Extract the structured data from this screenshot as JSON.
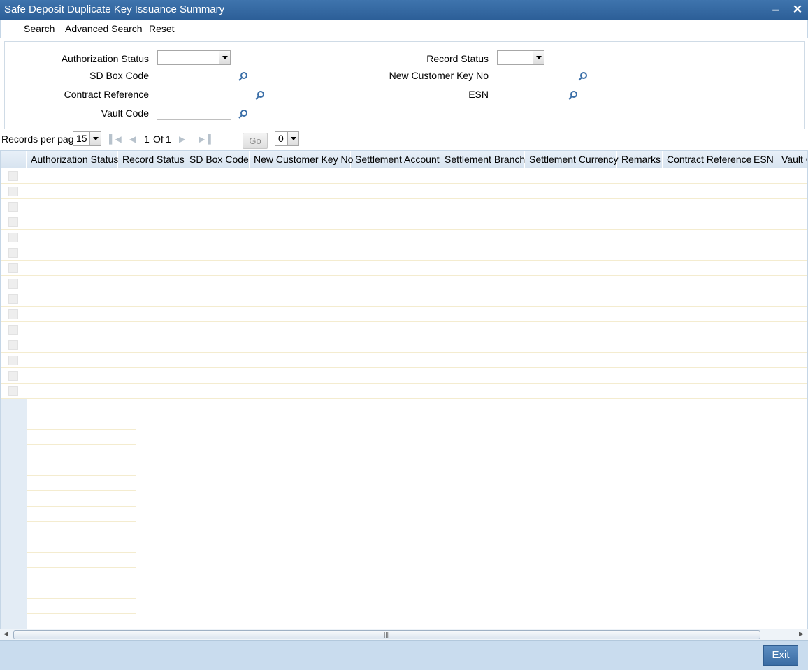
{
  "window": {
    "title": "Safe Deposit Duplicate Key Issuance Summary",
    "minimize_glyph": "‒",
    "close_glyph": "✕"
  },
  "menu": {
    "search": "Search",
    "advanced_search": "Advanced Search",
    "reset": "Reset"
  },
  "criteria": {
    "authorization_status": {
      "label": "Authorization Status",
      "value": ""
    },
    "record_status": {
      "label": "Record Status",
      "value": ""
    },
    "sd_box_code": {
      "label": "SD Box Code",
      "value": ""
    },
    "new_customer_key_no": {
      "label": "New Customer Key No",
      "value": ""
    },
    "contract_reference": {
      "label": "Contract Reference",
      "value": ""
    },
    "esn": {
      "label": "ESN",
      "value": ""
    },
    "vault_code": {
      "label": "Vault Code",
      "value": ""
    }
  },
  "pager": {
    "records_per_page_label": "Records per page",
    "records_per_page_value": "15",
    "current_page": "1",
    "of_label": "Of",
    "total_pages": "1",
    "go_label": "Go",
    "goto_value": "",
    "extra_select_value": "0"
  },
  "grid": {
    "columns": [
      "Authorization Status",
      "Record Status",
      "SD Box Code",
      "New Customer Key No",
      "Settlement Account",
      "Settlement Branch",
      "Settlement Currency",
      "Remarks",
      "Contract Reference",
      "ESN",
      "Vault C"
    ],
    "row_count": 15,
    "rows": []
  },
  "footer": {
    "exit_label": "Exit"
  },
  "colors": {
    "titlebar": "#2f6399",
    "footer": "#c9dcee",
    "exit_button": "#4a7db5"
  },
  "icons": {
    "lookup": "search-lens-icon",
    "first": "first-page-icon",
    "prev": "prev-page-icon",
    "next": "next-page-icon",
    "last": "last-page-icon"
  }
}
